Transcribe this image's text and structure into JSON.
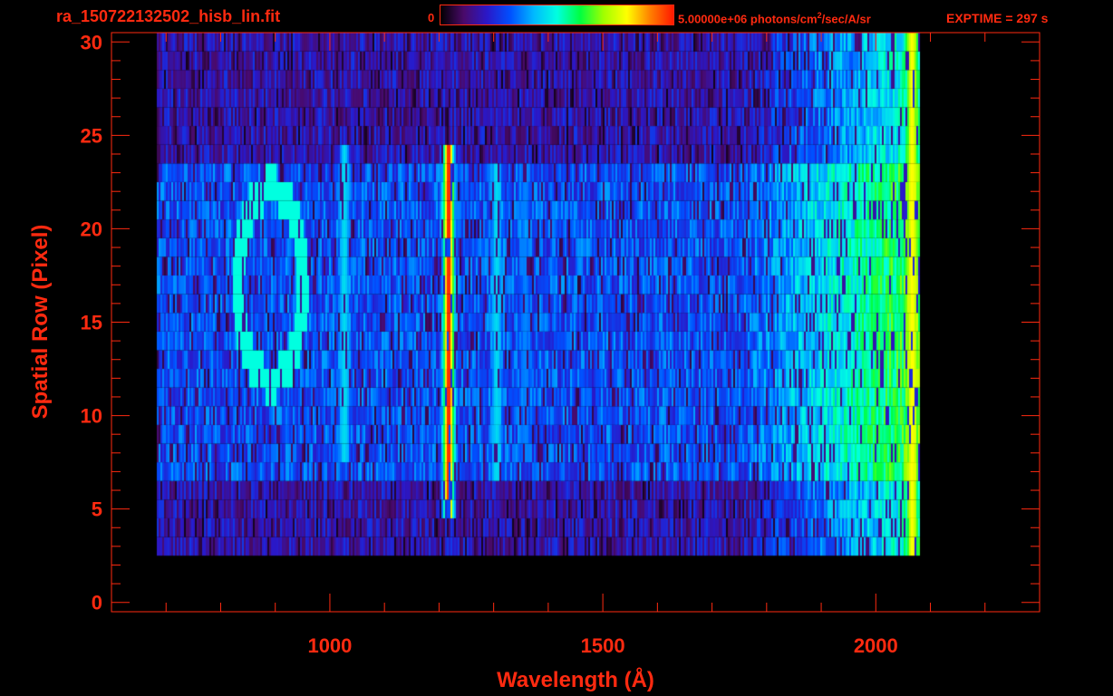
{
  "header": {
    "file_title": "ra_150722132502_hisb_lin.fit",
    "colorbar_min": "0",
    "colorbar_max_prefix": "5.00000e+06 photons/cm",
    "colorbar_max_exp": "2",
    "colorbar_max_suffix": "/sec/A/sr",
    "exptime": "EXPTIME = 297 s"
  },
  "colors": {
    "axis": "#ff2a10",
    "background": "#000000",
    "colormap": [
      "#000000",
      "#4a0a6a",
      "#2a18c8",
      "#0050ff",
      "#00b8ff",
      "#00ffe0",
      "#00ff40",
      "#a0ff00",
      "#ffff00",
      "#ff8000",
      "#ff1800"
    ]
  },
  "chart_data": {
    "type": "heatmap",
    "title": "",
    "xlabel": "Wavelength (Å)",
    "ylabel": "Spatial Row (Pixel)",
    "xlim": [
      600,
      2300
    ],
    "ylim": [
      -0.5,
      30.5
    ],
    "xticks": [
      1000,
      1500,
      2000
    ],
    "yticks": [
      0,
      5,
      10,
      15,
      20,
      25,
      30
    ],
    "colorbar_range": [
      "0",
      "5.00000e+06"
    ],
    "colorbar_units": "photons/cm^2/sec/A/sr",
    "rows": [
      0,
      30
    ],
    "wavelength_range": [
      680,
      2080
    ],
    "emission_lines": [
      {
        "wavelength": 1216,
        "rows": [
          5,
          24
        ],
        "peak_level": 1.0
      },
      {
        "wavelength": 1025,
        "rows": [
          8,
          24
        ],
        "peak_level": 0.45
      },
      {
        "wavelength": 1304,
        "rows": [
          7,
          23
        ],
        "peak_level": 0.45
      },
      {
        "wavelength": 1356,
        "rows": [
          8,
          23
        ],
        "peak_level": 0.35
      },
      {
        "wavelength": 2065,
        "rows": [
          3,
          30
        ],
        "peak_level": 0.8
      }
    ],
    "annotation_glyph": {
      "text": "O",
      "wavelength_range": [
        820,
        960
      ],
      "rows": [
        11,
        23
      ],
      "level": 0.5
    }
  }
}
